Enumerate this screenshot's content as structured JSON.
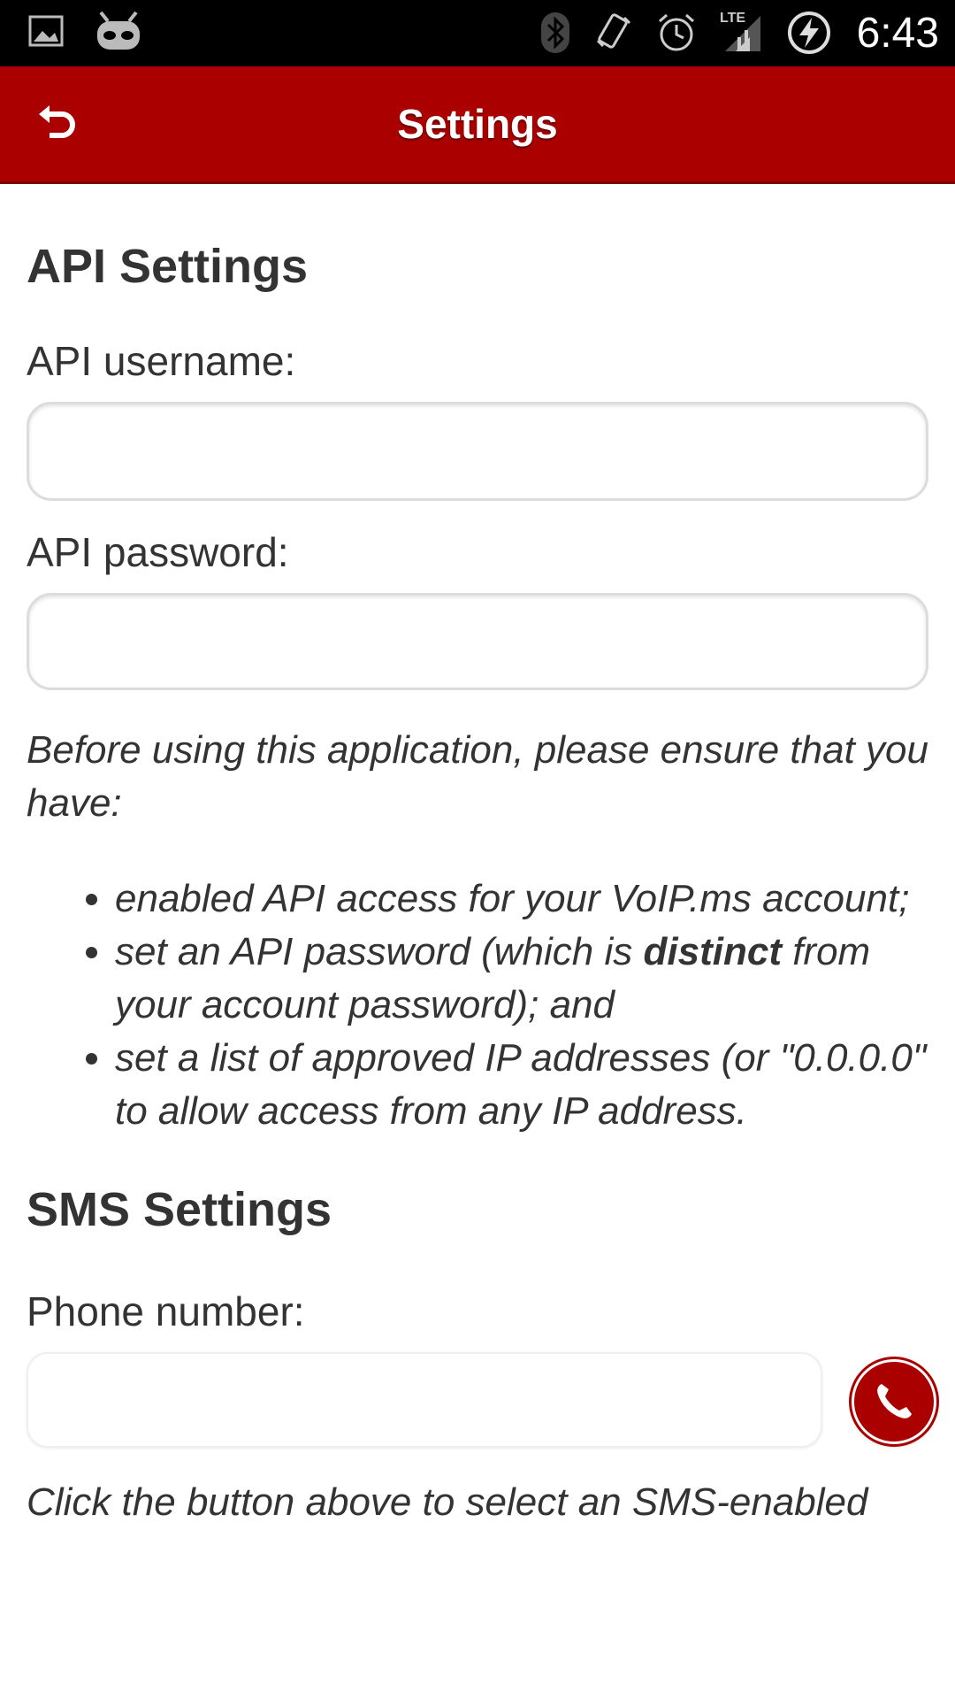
{
  "status_bar": {
    "time": "6:43",
    "icons": [
      "image-icon",
      "cyanogen-android-icon",
      "bluetooth-icon",
      "vibrate-icon",
      "alarm-icon",
      "lte-signal-icon",
      "battery-charging-icon"
    ],
    "network_label": "LTE"
  },
  "app_bar": {
    "title": "Settings",
    "back_icon": "back-arrow-icon",
    "background_color": "#aa0000"
  },
  "api_settings": {
    "heading": "API Settings",
    "username_label": "API username:",
    "username_value": "",
    "password_label": "API password:",
    "password_value": ""
  },
  "info": {
    "intro": "Before using this application, please ensure that you have:",
    "item1": "enabled API access for your VoIP.ms account;",
    "item2_before": "set an API password (which is ",
    "item2_bold": "distinct",
    "item2_after": " from your account password); and",
    "item3": "set a list of approved IP addresses (or \"0.0.0.0\" to allow access from any IP address."
  },
  "sms_settings": {
    "heading": "SMS Settings",
    "phone_label": "Phone number:",
    "phone_value": "",
    "call_button_icon": "phone-icon",
    "footer_note": "Click the button above to select an SMS-enabled"
  }
}
